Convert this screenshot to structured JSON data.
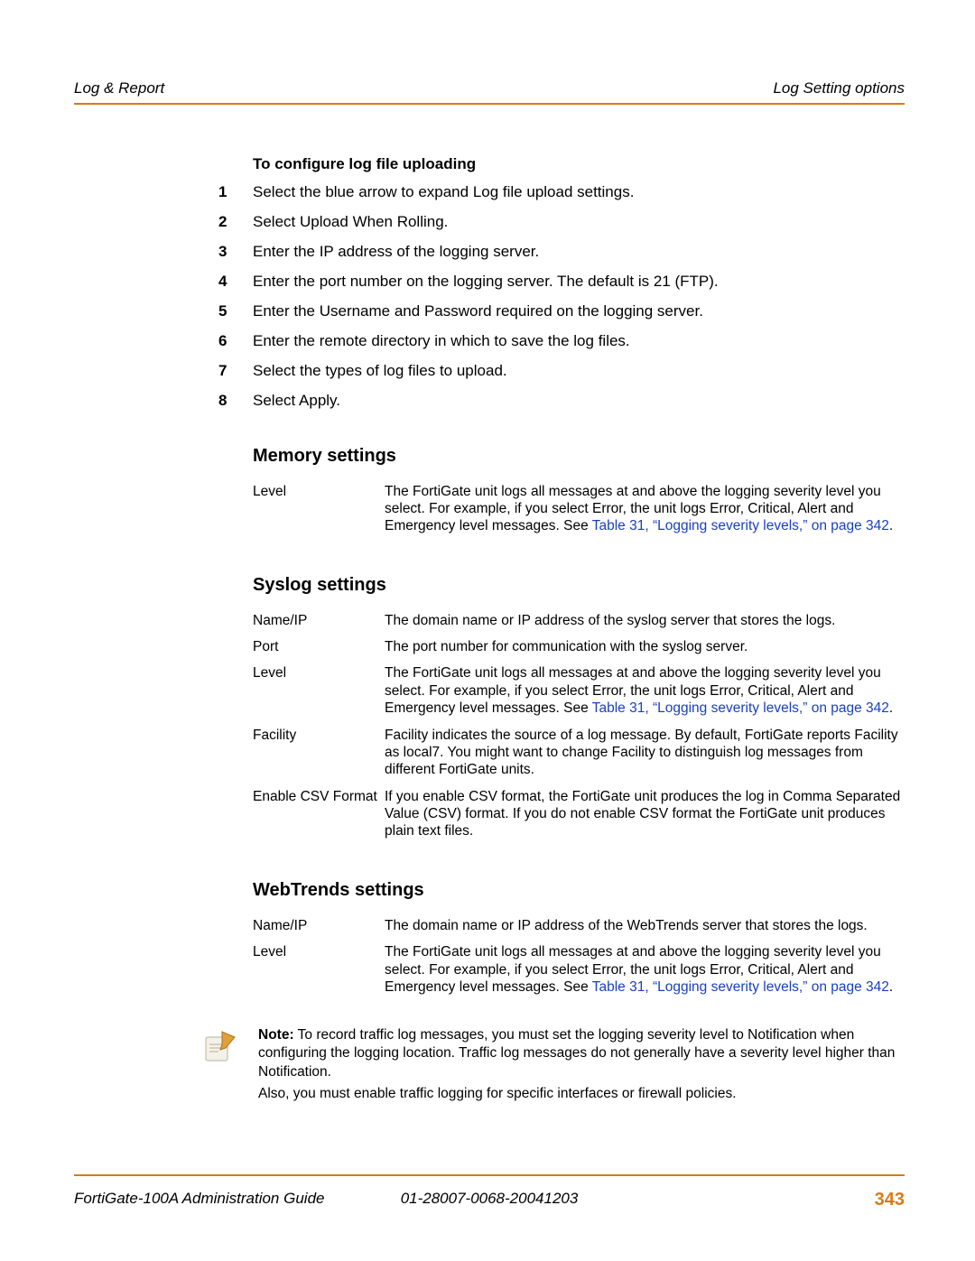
{
  "header": {
    "left": "Log & Report",
    "right": "Log Setting options"
  },
  "proc_title": "To configure log file uploading",
  "steps": [
    "Select the blue arrow to expand Log file upload settings.",
    "Select Upload When Rolling.",
    "Enter the IP address of the logging server.",
    "Enter the port number on the logging server. The default is 21 (FTP).",
    "Enter the Username and Password required on the logging server.",
    "Enter the remote directory in which to save the log files.",
    "Select the types of log files to upload.",
    "Select Apply."
  ],
  "xref": "Table 31, “Logging severity levels,” on page 342",
  "memory": {
    "heading": "Memory settings",
    "rows": [
      {
        "term": "Level",
        "desc": "The FortiGate unit logs all messages at and above the logging severity level you select. For example, if you select Error, the unit logs Error, Critical, Alert and Emergency level messages. See "
      }
    ]
  },
  "syslog": {
    "heading": "Syslog settings",
    "rows": [
      {
        "term": "Name/IP",
        "desc": "The domain name or IP address of the syslog server that stores the logs."
      },
      {
        "term": "Port",
        "desc": "The port number for communication with the syslog server."
      },
      {
        "term": "Level",
        "desc": "The FortiGate unit logs all messages at and above the logging severity level you select. For example, if you select Error, the unit logs Error, Critical, Alert and Emergency level messages. See "
      },
      {
        "term": "Facility",
        "desc": "Facility indicates the source of a log message. By default, FortiGate reports Facility as local7. You might want to change Facility to distinguish log messages from different FortiGate units."
      },
      {
        "term": "Enable CSV Format",
        "desc": "If you enable CSV format, the FortiGate unit produces the log in Comma Separated Value (CSV) format. If you do not enable CSV format the FortiGate unit produces plain text files."
      }
    ]
  },
  "webtrends": {
    "heading": "WebTrends settings",
    "rows": [
      {
        "term": "Name/IP",
        "desc": "The domain name or IP address of the WebTrends server that stores the logs."
      },
      {
        "term": "Level",
        "desc": "The FortiGate unit logs all messages at and above the logging severity level you select. For example, if you select Error, the unit logs Error, Critical, Alert and Emergency level messages. See "
      }
    ]
  },
  "note": {
    "label": "Note:",
    "body1": " To record traffic log messages, you must set the logging severity level to Notification when configuring the logging location. Traffic log messages do not generally have a severity level higher than Notification.",
    "body2": "Also, you must enable traffic logging for specific interfaces or firewall policies."
  },
  "footer": {
    "left": "FortiGate-100A Administration Guide",
    "mid": "01-28007-0068-20041203",
    "page": "343"
  }
}
